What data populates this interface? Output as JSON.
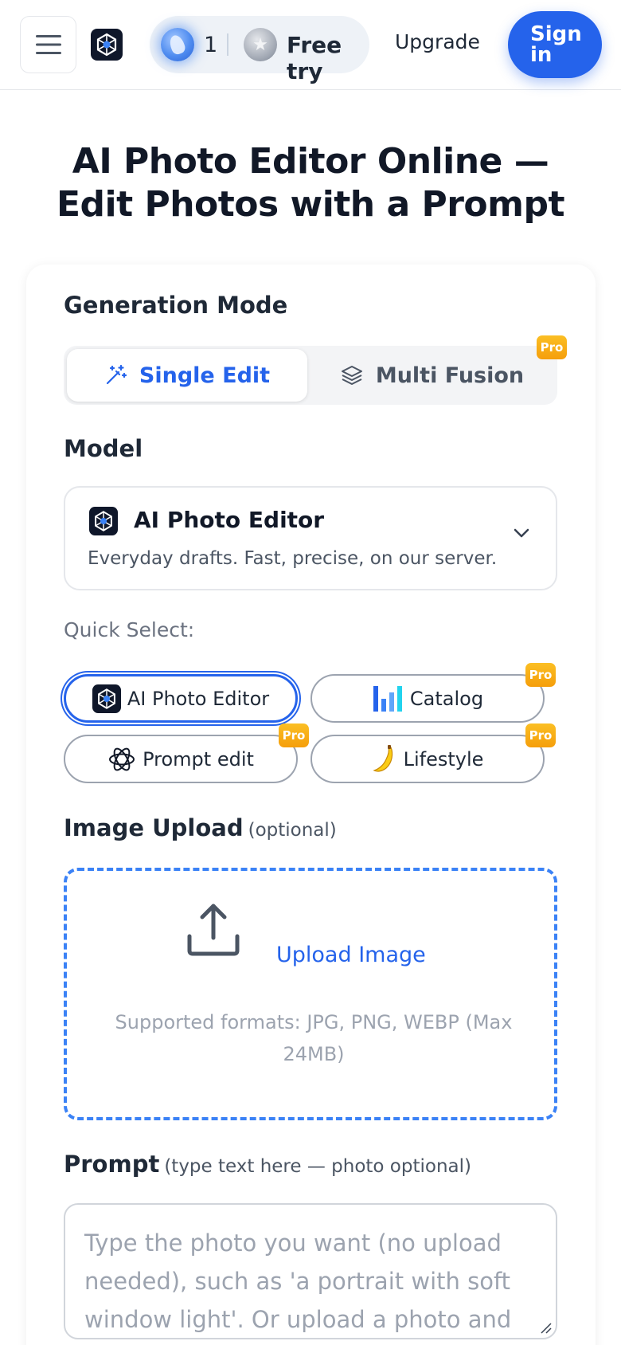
{
  "header": {
    "credit_count": "1",
    "free_try_label": "Free try",
    "upgrade_label": "Upgrade",
    "signin_label": "Sign in"
  },
  "page": {
    "title": "AI Photo Editor Online — Edit Photos with a Prompt"
  },
  "generation_mode": {
    "label": "Generation Mode",
    "options": [
      {
        "label": "Single Edit",
        "selected": true,
        "pro": false
      },
      {
        "label": "Multi Fusion",
        "selected": false,
        "pro": true
      }
    ]
  },
  "model": {
    "label": "Model",
    "selected_name": "AI Photo Editor",
    "selected_description": "Everyday drafts. Fast, precise, on our server."
  },
  "quick_select": {
    "label": "Quick Select:",
    "options": [
      {
        "label": "AI Photo Editor",
        "icon": "app-logo-icon",
        "active": true,
        "pro": false
      },
      {
        "label": "Catalog",
        "icon": "bar-chart-icon",
        "active": false,
        "pro": true
      },
      {
        "label": "Prompt edit",
        "icon": "openai-knot-icon",
        "active": false,
        "pro": true
      },
      {
        "label": "Lifestyle",
        "icon": "banana-icon",
        "active": false,
        "pro": true
      }
    ]
  },
  "pro_label": "Pro",
  "image_upload": {
    "label": "Image Upload",
    "sublabel": "(optional)",
    "action_label": "Upload Image",
    "formats_text": "Supported formats: JPG, PNG, WEBP (Max 24MB)"
  },
  "prompt": {
    "label": "Prompt",
    "sublabel": "(type text here — photo optional)",
    "placeholder": "Type the photo you want (no upload needed), such as 'a portrait with soft window light'. Or upload a photo and"
  },
  "colors": {
    "accent": "#2563eb",
    "pro_badge": "#f59e0b",
    "upload_border": "#3b82f6"
  }
}
